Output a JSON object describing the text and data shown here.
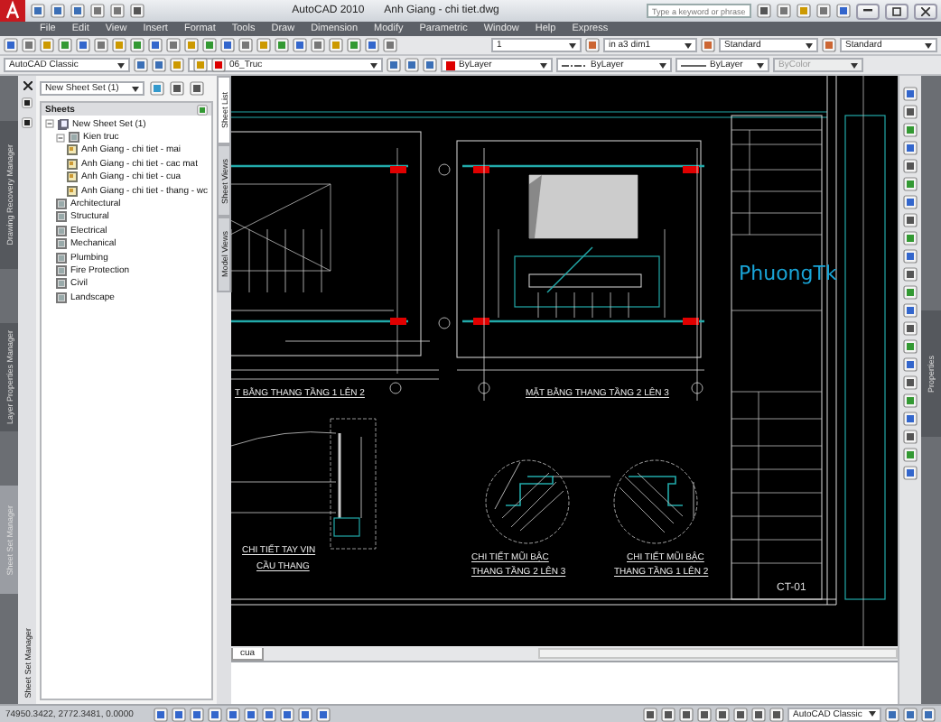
{
  "window": {
    "app": "AutoCAD 2010",
    "document": "Anh Giang - chi tiet.dwg"
  },
  "search": {
    "placeholder": "Type a keyword or phrase"
  },
  "menu": [
    "File",
    "Edit",
    "View",
    "Insert",
    "Format",
    "Tools",
    "Draw",
    "Dimension",
    "Modify",
    "Parametric",
    "Window",
    "Help",
    "Express"
  ],
  "toolbar_dropdowns": [
    {
      "value": "1"
    },
    {
      "value": "in a3 dim1"
    },
    {
      "value": "Standard"
    },
    {
      "value": "Standard"
    }
  ],
  "workspace_dropdown": "AutoCAD Classic",
  "layer_dropdown": "06_Truc",
  "property_dropdowns": [
    {
      "kind": "color",
      "value": "ByLayer",
      "disabled": false
    },
    {
      "kind": "linetype",
      "value": "ByLayer",
      "disabled": false
    },
    {
      "kind": "lineweight",
      "value": "ByLayer",
      "disabled": false
    },
    {
      "kind": "plotstyle",
      "value": "ByColor",
      "disabled": true
    }
  ],
  "side_tabs": [
    {
      "label": "Drawing Recovery Manager",
      "selected": false
    },
    {
      "label": "Layer Properties Manager",
      "selected": false
    },
    {
      "label": "Sheet Set Manager",
      "selected": true
    }
  ],
  "sheet_set": {
    "title": "Sheet Set Manager",
    "dropdown": "New Sheet Set (1)",
    "header": "Sheets",
    "tree": [
      {
        "label": "New Sheet Set (1)",
        "kind": "set",
        "children": [
          {
            "label": "Kien truc",
            "kind": "subset",
            "children": [
              {
                "label": "Anh Giang - chi tiet - mai",
                "kind": "sheet"
              },
              {
                "label": "Anh Giang - chi tiet - cac mat",
                "kind": "sheet"
              },
              {
                "label": "Anh Giang - chi tiet - cua",
                "kind": "sheet"
              },
              {
                "label": "Anh Giang - chi tiet - thang - wc",
                "kind": "sheet"
              }
            ]
          },
          {
            "label": "Architectural",
            "kind": "subset"
          },
          {
            "label": "Structural",
            "kind": "subset"
          },
          {
            "label": "Electrical",
            "kind": "subset"
          },
          {
            "label": "Mechanical",
            "kind": "subset"
          },
          {
            "label": "Plumbing",
            "kind": "subset"
          },
          {
            "label": "Fire Protection",
            "kind": "subset"
          },
          {
            "label": "Civil",
            "kind": "subset"
          },
          {
            "label": "Landscape",
            "kind": "subset"
          }
        ]
      }
    ],
    "tabs": [
      {
        "label": "Sheet List",
        "selected": true
      },
      {
        "label": "Sheet Views",
        "selected": false
      },
      {
        "label": "Model Views",
        "selected": false
      }
    ]
  },
  "drawing": {
    "titles": [
      "T BẰNG THANG TẦNG 1 LÊN 2",
      "MẶT BẰNG THANG TẦNG 2 LÊN 3",
      "CHI TIẾT TAY VỊN",
      "CẦU THANG",
      "CHI TIẾT MŨI BẬC",
      "THANG TẦNG 2 LÊN 3",
      "CHI TIẾT MŨI BẬC",
      "THANG TẦNG 1 LÊN 2"
    ],
    "logo": "PhuongTk",
    "sheet_number": "CT-01"
  },
  "layout_tab": "cua",
  "right_tab": "Properties",
  "status_bar": {
    "coordinates": "74950.3422, 2772.3481, 0.0000",
    "workspace": "AutoCAD Classic"
  }
}
